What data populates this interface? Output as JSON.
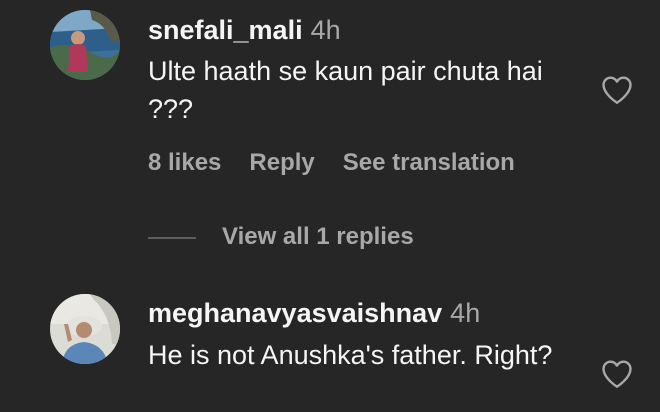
{
  "comments": [
    {
      "username": "snefali_mali",
      "time": "4h",
      "text": "Ulte haath se kaun pair chuta hai ???",
      "likes": "8 likes",
      "reply": "Reply",
      "translate": "See translation",
      "view_replies": "View all 1 replies"
    },
    {
      "username": "meghanavyasvaishnav",
      "time": "4h",
      "text": "He is not Anushka's father. Right?"
    }
  ],
  "icons": {
    "like": "heart-outline-icon"
  },
  "colors": {
    "background": "#262626",
    "primary_text": "#f5f5f5",
    "secondary_text": "#a8a8a8"
  }
}
